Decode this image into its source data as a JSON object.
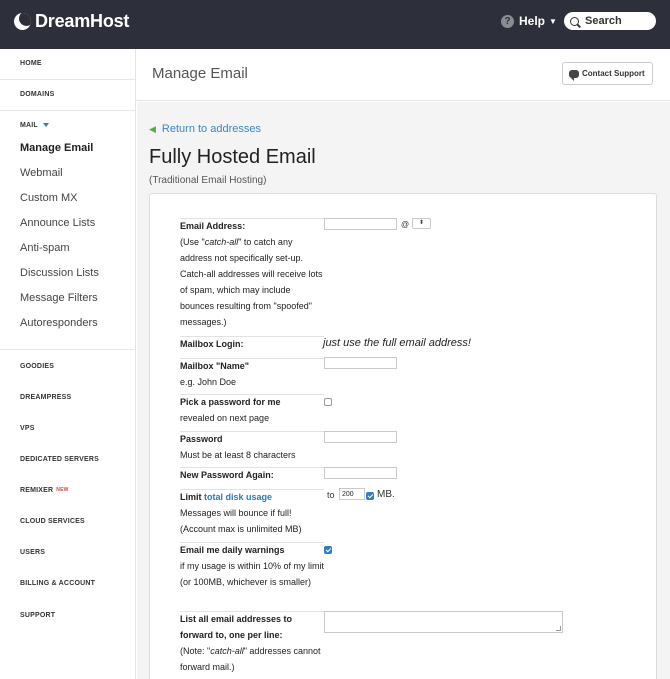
{
  "topbar": {
    "brand": "DreamHost",
    "help_label": "Help",
    "search_label": "Search"
  },
  "sidebar": {
    "home": "HOME",
    "domains": "DOMAINS",
    "mail": "MAIL",
    "mail_items": [
      "Manage Email",
      "Webmail",
      "Custom MX",
      "Announce Lists",
      "Anti-spam",
      "Discussion Lists",
      "Message Filters",
      "Autoresponders"
    ],
    "sections": [
      "GOODIES",
      "DREAMPRESS",
      "VPS",
      "DEDICATED SERVERS",
      "REMIXER",
      "CLOUD SERVICES",
      "USERS",
      "BILLING & ACCOUNT",
      "SUPPORT"
    ],
    "remixer_badge": "NEW"
  },
  "header": {
    "title": "Manage Email",
    "contact_support": "Contact Support"
  },
  "main": {
    "back_link": "Return to addresses",
    "title": "Fully Hosted Email",
    "subtitle": "(Traditional Email Hosting)"
  },
  "form": {
    "email_address": {
      "label": "Email Address:",
      "help_pre": "(Use \"",
      "help_em": "catch-all",
      "help_post": "\" to catch any address not specifically set-up. Catch-all addresses will receive lots of spam, which may include bounces resulting from \"spoofed\" messages.)",
      "at": "@",
      "domain_select": "⬍",
      "value": ""
    },
    "mailbox_login": {
      "label": "Mailbox Login:",
      "note": "just use the full email address!"
    },
    "mailbox_name": {
      "label": "Mailbox \"Name\"",
      "example": "e.g. John Doe",
      "value": ""
    },
    "pick_password": {
      "label": "Pick a password for me",
      "sub": "revealed on next page",
      "checked": false
    },
    "password": {
      "label": "Password",
      "sub": "Must be at least 8 characters",
      "value": ""
    },
    "password_again": {
      "label": "New Password Again:",
      "value": ""
    },
    "limit": {
      "label_pre": "Limit",
      "label_link": "total disk usage",
      "sub": "Messages will bounce if full! (Account max is unlimited MB)",
      "to": "to",
      "value": "200",
      "unit": "MB.",
      "checked": true
    },
    "warnings": {
      "label": "Email me daily warnings",
      "sub": "if my usage is within 10% of my limit (or 100MB, whichever is smaller)",
      "checked": true
    },
    "forward": {
      "label": "List all email addresses to forward to, one per line:",
      "note_pre": "(Note: \"",
      "note_em": "catch-all",
      "note_post": "\" addresses cannot forward mail.)",
      "value": ""
    }
  },
  "colors": {
    "topbar_bg": "#2d2f3a",
    "link": "#3a86c6",
    "accent": "#2f7fc1",
    "main_bg": "#f4f4f4"
  }
}
